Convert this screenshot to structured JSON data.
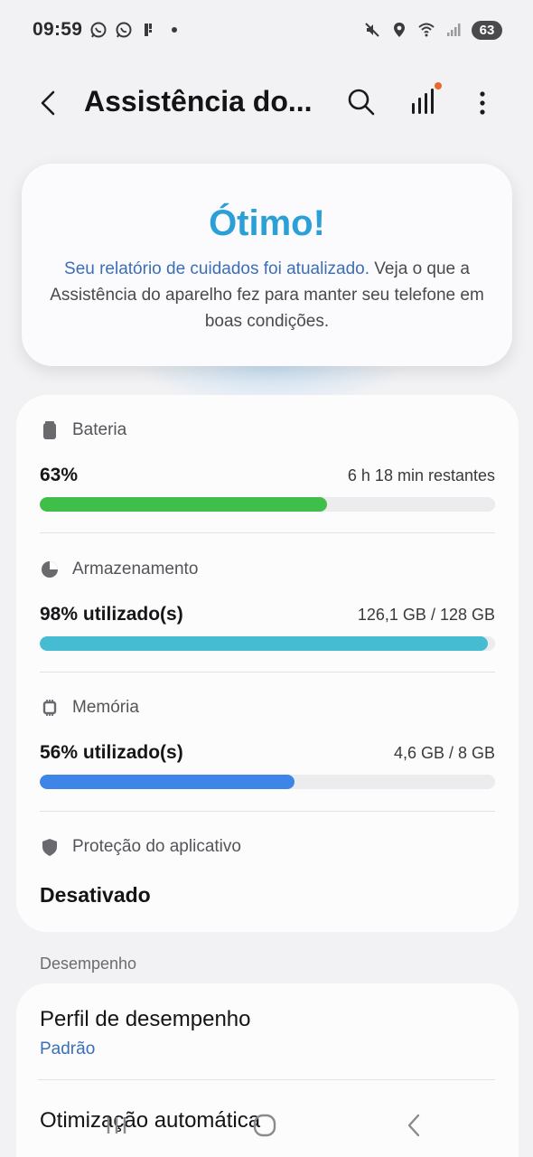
{
  "status_bar": {
    "time": "09:59",
    "battery": "63",
    "left_icons": [
      "whatsapp-icon",
      "whatsapp-icon",
      "app-notification-icon",
      "dot-icon"
    ],
    "right_icons": [
      "mute-icon",
      "location-icon",
      "wifi-icon",
      "signal-icon"
    ]
  },
  "app_bar": {
    "title": "Assistência do...",
    "notification_dot_color": "#e8692b"
  },
  "hero": {
    "title": "Ótimo!",
    "link_text": "Seu relatório de cuidados foi atualizado.",
    "body_text": " Veja o que a Assistência do aparelho fez para manter seu telefone em boas condições."
  },
  "stats": {
    "battery": {
      "label": "Bateria",
      "value": "63%",
      "detail": "6 h 18 min restantes",
      "fill": 0.63,
      "color": "#3fbf4a"
    },
    "storage": {
      "label": "Armazenamento",
      "value": "98% utilizado(s)",
      "detail": "126,1 GB / 128 GB",
      "fill": 0.985,
      "color": "#46bcd3"
    },
    "memory": {
      "label": "Memória",
      "value": "56% utilizado(s)",
      "detail": "4,6 GB / 8 GB",
      "fill": 0.56,
      "color": "#3d86e8"
    },
    "protection": {
      "label": "Proteção do aplicativo",
      "value": "Desativado"
    }
  },
  "performance": {
    "section_label": "Desempenho",
    "profile_title": "Perfil de desempenho",
    "profile_value": "Padrão",
    "auto_opt_title": "Otimização automática"
  }
}
